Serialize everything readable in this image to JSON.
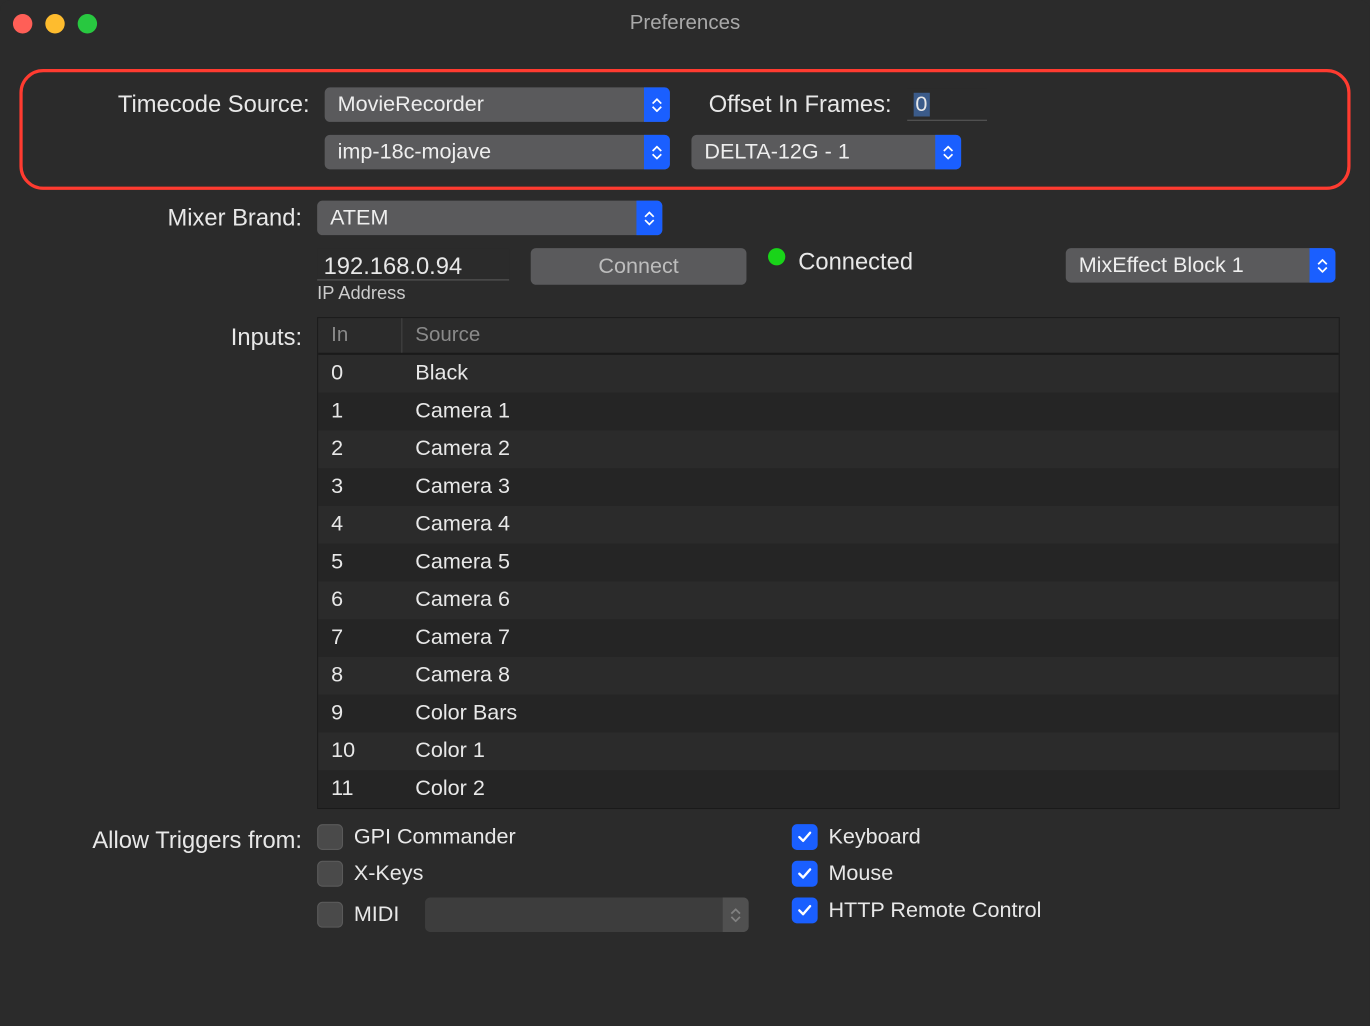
{
  "window": {
    "title": "Preferences"
  },
  "timecode": {
    "label": "Timecode Source:",
    "source": "MovieRecorder",
    "offset_label": "Offset In Frames:",
    "offset_value": "0",
    "host": "imp-18c-mojave",
    "device": "DELTA-12G - 1"
  },
  "mixer": {
    "label": "Mixer Brand:",
    "brand": "ATEM",
    "ip_value": "192.168.0.94",
    "ip_label": "IP Address",
    "connect_label": "Connect",
    "status_text": "Connected",
    "block": "MixEffect Block 1"
  },
  "inputs": {
    "label": "Inputs:",
    "headers": {
      "in": "In",
      "source": "Source"
    },
    "rows": [
      {
        "in": "0",
        "source": "Black"
      },
      {
        "in": "1",
        "source": "Camera 1"
      },
      {
        "in": "2",
        "source": "Camera 2"
      },
      {
        "in": "3",
        "source": "Camera 3"
      },
      {
        "in": "4",
        "source": "Camera 4"
      },
      {
        "in": "5",
        "source": "Camera 5"
      },
      {
        "in": "6",
        "source": "Camera 6"
      },
      {
        "in": "7",
        "source": "Camera 7"
      },
      {
        "in": "8",
        "source": "Camera 8"
      },
      {
        "in": "9",
        "source": "Color Bars"
      },
      {
        "in": "10",
        "source": "Color 1"
      },
      {
        "in": "11",
        "source": "Color 2"
      }
    ]
  },
  "triggers": {
    "label": "Allow Triggers from:",
    "left": [
      {
        "label": "GPI Commander",
        "checked": false
      },
      {
        "label": "X-Keys",
        "checked": false
      },
      {
        "label": "MIDI",
        "checked": false,
        "has_popup": true
      }
    ],
    "right": [
      {
        "label": "Keyboard",
        "checked": true
      },
      {
        "label": "Mouse",
        "checked": true
      },
      {
        "label": "HTTP Remote Control",
        "checked": true
      }
    ]
  }
}
